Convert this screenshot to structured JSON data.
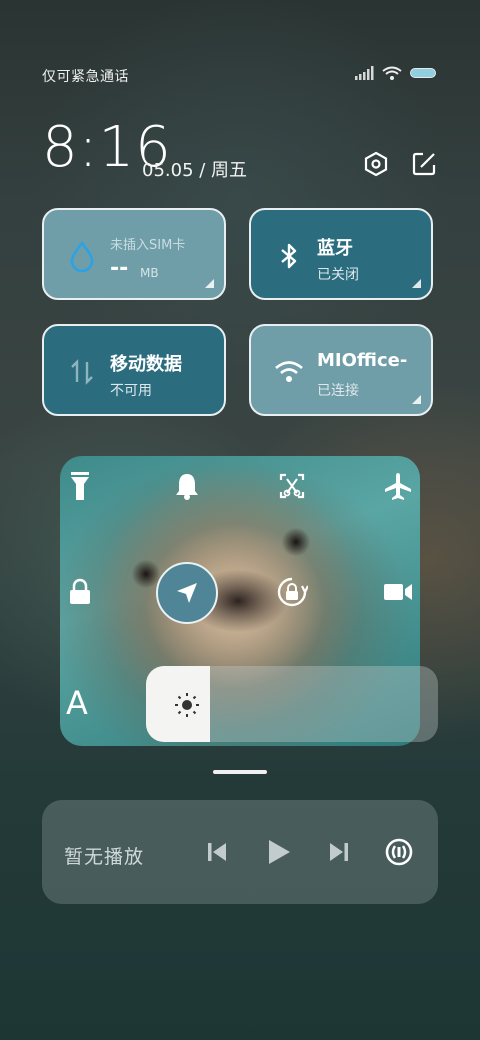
{
  "status_bar": {
    "text": "仅可紧急通话",
    "icons": [
      "signal-icon",
      "wifi-icon",
      "battery-icon"
    ]
  },
  "clock": {
    "time": "8:16",
    "date": "05.05 / 周五"
  },
  "header_icons": [
    "settings-icon",
    "edit-icon"
  ],
  "tiles": [
    {
      "title": "未插入SIM卡",
      "value": "--",
      "unit": "MB",
      "icon": "data-drop-icon",
      "style": "light"
    },
    {
      "title": "蓝牙",
      "sub": "已关闭",
      "icon": "bluetooth-icon",
      "style": "dark"
    },
    {
      "title": "移动数据",
      "sub": "不可用",
      "icon": "mobile-data-icon",
      "style": "dark"
    },
    {
      "title": "MIOffice-",
      "sub": "已连接",
      "icon": "wifi-icon",
      "style": "light"
    }
  ],
  "toggles": [
    "flashlight-icon",
    "bell-icon",
    "screenshot-icon",
    "airplane-icon",
    "lock-icon",
    "location-icon",
    "rotation-lock-icon",
    "screen-record-icon"
  ],
  "brightness": {
    "level": 0.22,
    "icon": "sun-icon"
  },
  "font_size_label": "A",
  "media": {
    "label": "暂无播放",
    "controls": [
      "previous-icon",
      "play-icon",
      "next-icon",
      "cast-icon"
    ]
  },
  "colors": {
    "tile_light": "#6f9ea8",
    "tile_dark": "#2b6d7e",
    "accent": "#4f8596"
  }
}
